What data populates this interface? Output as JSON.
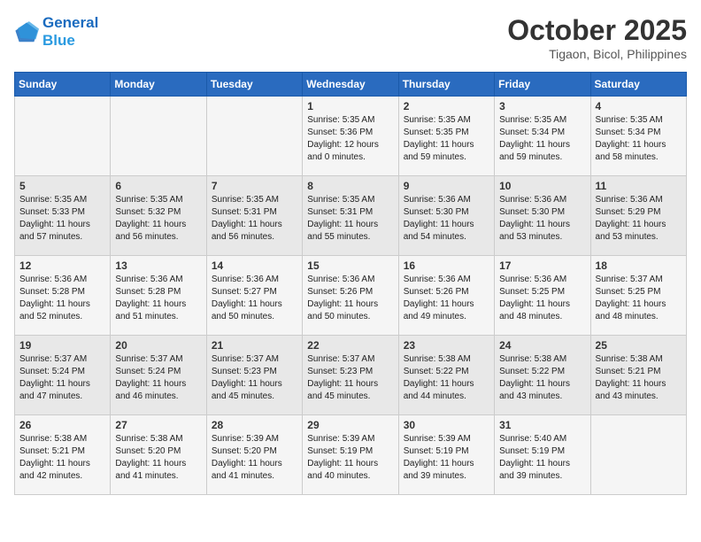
{
  "header": {
    "logo_line1": "General",
    "logo_line2": "Blue",
    "month": "October 2025",
    "location": "Tigaon, Bicol, Philippines"
  },
  "weekdays": [
    "Sunday",
    "Monday",
    "Tuesday",
    "Wednesday",
    "Thursday",
    "Friday",
    "Saturday"
  ],
  "weeks": [
    [
      {
        "day": "",
        "info": ""
      },
      {
        "day": "",
        "info": ""
      },
      {
        "day": "",
        "info": ""
      },
      {
        "day": "1",
        "info": "Sunrise: 5:35 AM\nSunset: 5:36 PM\nDaylight: 12 hours\nand 0 minutes."
      },
      {
        "day": "2",
        "info": "Sunrise: 5:35 AM\nSunset: 5:35 PM\nDaylight: 11 hours\nand 59 minutes."
      },
      {
        "day": "3",
        "info": "Sunrise: 5:35 AM\nSunset: 5:34 PM\nDaylight: 11 hours\nand 59 minutes."
      },
      {
        "day": "4",
        "info": "Sunrise: 5:35 AM\nSunset: 5:34 PM\nDaylight: 11 hours\nand 58 minutes."
      }
    ],
    [
      {
        "day": "5",
        "info": "Sunrise: 5:35 AM\nSunset: 5:33 PM\nDaylight: 11 hours\nand 57 minutes."
      },
      {
        "day": "6",
        "info": "Sunrise: 5:35 AM\nSunset: 5:32 PM\nDaylight: 11 hours\nand 56 minutes."
      },
      {
        "day": "7",
        "info": "Sunrise: 5:35 AM\nSunset: 5:31 PM\nDaylight: 11 hours\nand 56 minutes."
      },
      {
        "day": "8",
        "info": "Sunrise: 5:35 AM\nSunset: 5:31 PM\nDaylight: 11 hours\nand 55 minutes."
      },
      {
        "day": "9",
        "info": "Sunrise: 5:36 AM\nSunset: 5:30 PM\nDaylight: 11 hours\nand 54 minutes."
      },
      {
        "day": "10",
        "info": "Sunrise: 5:36 AM\nSunset: 5:30 PM\nDaylight: 11 hours\nand 53 minutes."
      },
      {
        "day": "11",
        "info": "Sunrise: 5:36 AM\nSunset: 5:29 PM\nDaylight: 11 hours\nand 53 minutes."
      }
    ],
    [
      {
        "day": "12",
        "info": "Sunrise: 5:36 AM\nSunset: 5:28 PM\nDaylight: 11 hours\nand 52 minutes."
      },
      {
        "day": "13",
        "info": "Sunrise: 5:36 AM\nSunset: 5:28 PM\nDaylight: 11 hours\nand 51 minutes."
      },
      {
        "day": "14",
        "info": "Sunrise: 5:36 AM\nSunset: 5:27 PM\nDaylight: 11 hours\nand 50 minutes."
      },
      {
        "day": "15",
        "info": "Sunrise: 5:36 AM\nSunset: 5:26 PM\nDaylight: 11 hours\nand 50 minutes."
      },
      {
        "day": "16",
        "info": "Sunrise: 5:36 AM\nSunset: 5:26 PM\nDaylight: 11 hours\nand 49 minutes."
      },
      {
        "day": "17",
        "info": "Sunrise: 5:36 AM\nSunset: 5:25 PM\nDaylight: 11 hours\nand 48 minutes."
      },
      {
        "day": "18",
        "info": "Sunrise: 5:37 AM\nSunset: 5:25 PM\nDaylight: 11 hours\nand 48 minutes."
      }
    ],
    [
      {
        "day": "19",
        "info": "Sunrise: 5:37 AM\nSunset: 5:24 PM\nDaylight: 11 hours\nand 47 minutes."
      },
      {
        "day": "20",
        "info": "Sunrise: 5:37 AM\nSunset: 5:24 PM\nDaylight: 11 hours\nand 46 minutes."
      },
      {
        "day": "21",
        "info": "Sunrise: 5:37 AM\nSunset: 5:23 PM\nDaylight: 11 hours\nand 45 minutes."
      },
      {
        "day": "22",
        "info": "Sunrise: 5:37 AM\nSunset: 5:23 PM\nDaylight: 11 hours\nand 45 minutes."
      },
      {
        "day": "23",
        "info": "Sunrise: 5:38 AM\nSunset: 5:22 PM\nDaylight: 11 hours\nand 44 minutes."
      },
      {
        "day": "24",
        "info": "Sunrise: 5:38 AM\nSunset: 5:22 PM\nDaylight: 11 hours\nand 43 minutes."
      },
      {
        "day": "25",
        "info": "Sunrise: 5:38 AM\nSunset: 5:21 PM\nDaylight: 11 hours\nand 43 minutes."
      }
    ],
    [
      {
        "day": "26",
        "info": "Sunrise: 5:38 AM\nSunset: 5:21 PM\nDaylight: 11 hours\nand 42 minutes."
      },
      {
        "day": "27",
        "info": "Sunrise: 5:38 AM\nSunset: 5:20 PM\nDaylight: 11 hours\nand 41 minutes."
      },
      {
        "day": "28",
        "info": "Sunrise: 5:39 AM\nSunset: 5:20 PM\nDaylight: 11 hours\nand 41 minutes."
      },
      {
        "day": "29",
        "info": "Sunrise: 5:39 AM\nSunset: 5:19 PM\nDaylight: 11 hours\nand 40 minutes."
      },
      {
        "day": "30",
        "info": "Sunrise: 5:39 AM\nSunset: 5:19 PM\nDaylight: 11 hours\nand 39 minutes."
      },
      {
        "day": "31",
        "info": "Sunrise: 5:40 AM\nSunset: 5:19 PM\nDaylight: 11 hours\nand 39 minutes."
      },
      {
        "day": "",
        "info": ""
      }
    ]
  ]
}
